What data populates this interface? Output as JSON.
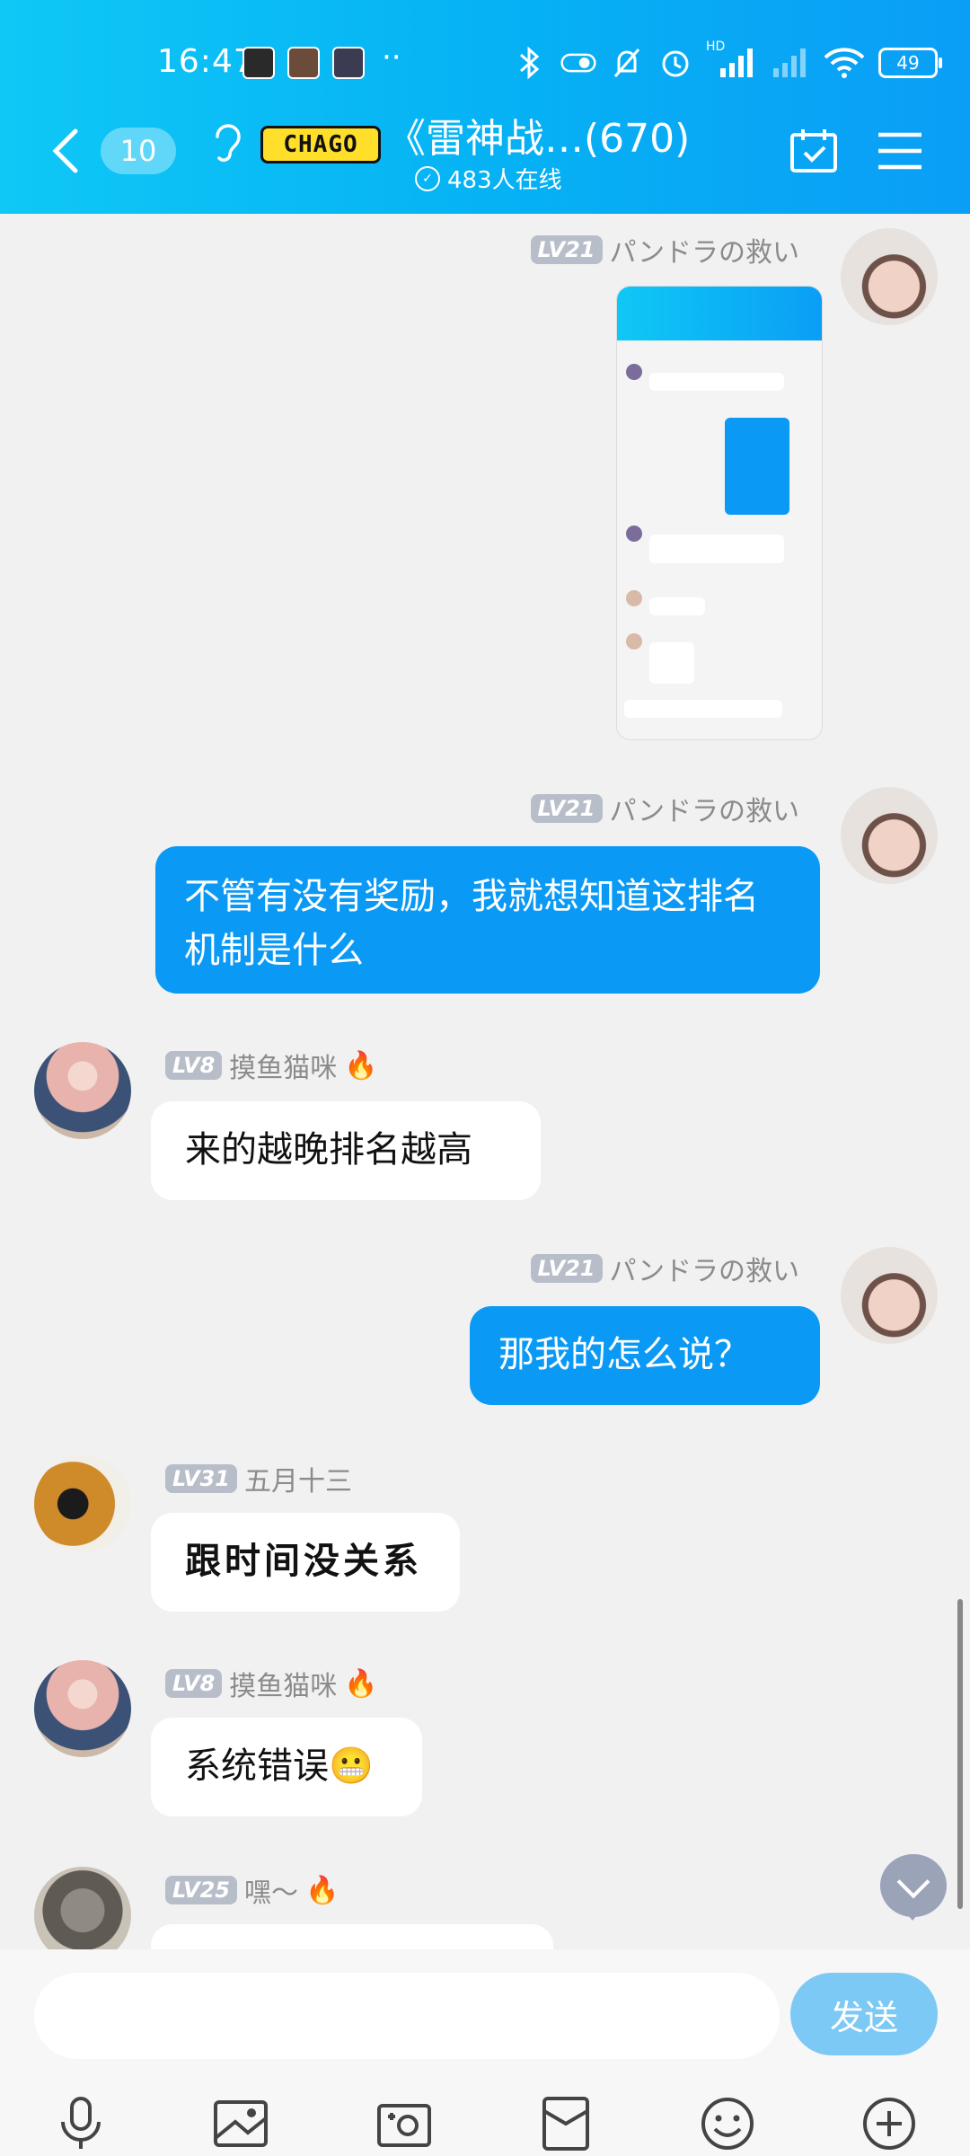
{
  "status_bar": {
    "time": "16:47",
    "battery": "49",
    "network_label": "HD"
  },
  "header": {
    "unread_count": "10",
    "group_logo_text": "CHAGO",
    "group_title": "《雷神战…(670)",
    "online_text": "483人在线"
  },
  "messages": [
    {
      "side": "right",
      "level": "LV21",
      "nickname": "パンドラの救い",
      "type": "image"
    },
    {
      "side": "right",
      "level": "LV21",
      "nickname": "パンドラの救い",
      "text": "不管有没有奖励，我就想知道这排名机制是什么"
    },
    {
      "side": "left",
      "level": "LV8",
      "nickname": "摸鱼猫咪",
      "text": "来的越晚排名越高"
    },
    {
      "side": "right",
      "level": "LV21",
      "nickname": "パンドラの救い",
      "text": "那我的怎么说？"
    },
    {
      "side": "left",
      "level": "LV31",
      "nickname": "五月十三",
      "text": "跟时间没关系"
    },
    {
      "side": "left",
      "level": "LV8",
      "nickname": "摸鱼猫咪",
      "text": "系统错误😬"
    },
    {
      "side": "left",
      "level": "LV25",
      "nickname": "嘿～",
      "text": ""
    }
  ],
  "input": {
    "placeholder": "",
    "send_label": "发送"
  },
  "toolbar_icons": [
    "microphone-icon",
    "image-icon",
    "camera-icon",
    "red-packet-icon",
    "emoji-icon",
    "plus-icon"
  ],
  "colors": {
    "header": "#06b2f4",
    "self_bubble": "#0a99f5",
    "send_button": "#7cc9f5",
    "level_badge": "#b8bec9"
  }
}
